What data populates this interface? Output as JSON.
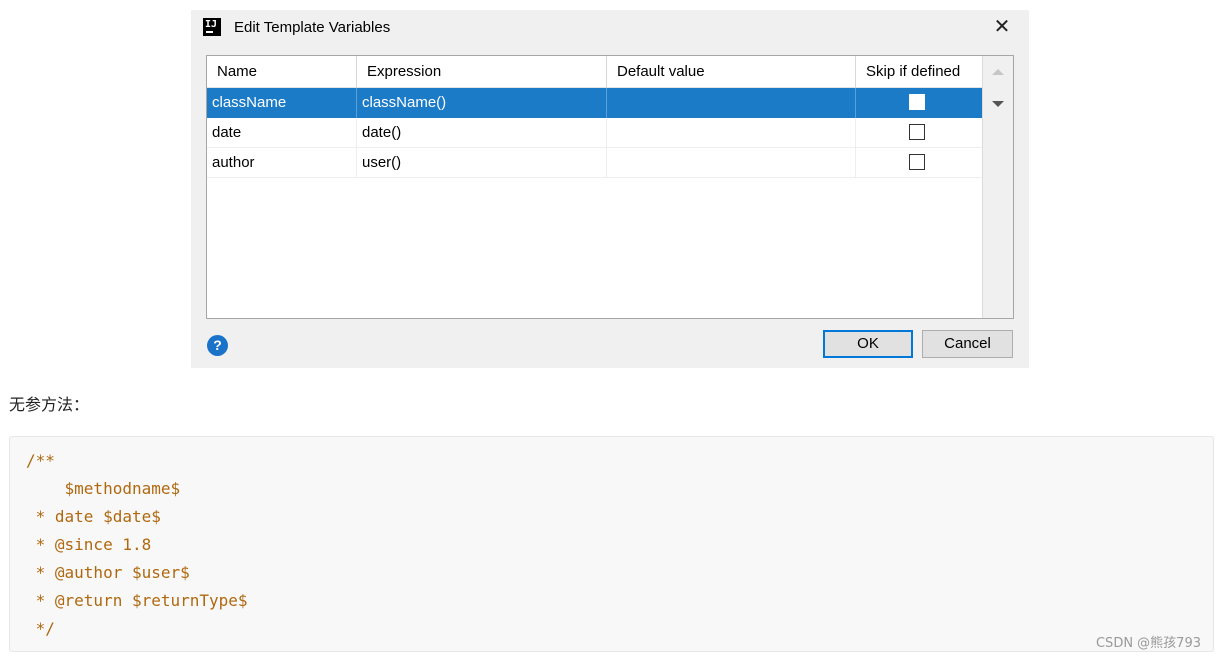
{
  "dialog": {
    "title": "Edit Template Variables",
    "close_glyph": "✕",
    "app_icon_text": "IJ",
    "columns": [
      "Name",
      "Expression",
      "Default value",
      "Skip if defined"
    ],
    "rows": [
      {
        "name": "className",
        "expression": "className()",
        "default": "",
        "skip": false
      },
      {
        "name": "date",
        "expression": "date()",
        "default": "",
        "skip": false
      },
      {
        "name": "author",
        "expression": "user()",
        "default": "",
        "skip": false
      }
    ],
    "help_glyph": "?",
    "ok_label": "OK",
    "cancel_label": "Cancel"
  },
  "caption": "无参方法：",
  "code": {
    "lines": [
      "/**",
      "    $methodname$",
      " * date $date$",
      " * @since 1.8",
      " * @author $user$",
      " * @return $returnType$",
      " */"
    ]
  },
  "watermark": "CSDN @熊孩793",
  "colors": {
    "selection": "#1b7bc7",
    "code_text": "#b0680f",
    "ok_border": "#0078d7"
  }
}
